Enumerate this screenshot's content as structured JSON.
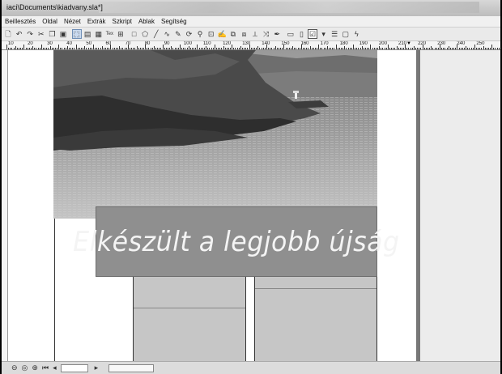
{
  "window": {
    "title": "iaci\\Documents\\kiadvany.sla*]"
  },
  "menu": [
    "Beillesztés",
    "Oldal",
    "Nézet",
    "Extrák",
    "Szkript",
    "Ablak",
    "Segítség"
  ],
  "toolbar": {
    "icons": [
      "new-icon",
      "undo-icon",
      "redo-icon",
      "cut-icon",
      "copy-icon",
      "paste-icon",
      "select-icon",
      "text-frame-icon",
      "image-frame-icon",
      "text-annotation-icon",
      "table-icon",
      "shape-icon",
      "polygon-icon",
      "line-icon",
      "bezier-icon",
      "freehand-icon",
      "rotate-icon",
      "zoom-icon",
      "edit-content-icon",
      "edit-text-icon",
      "link-frames-icon",
      "unlink-frames-icon",
      "measure-icon",
      "copy-properties-icon",
      "eyedropper-icon",
      "pdf-pushbutton-icon",
      "pdf-textfield-icon",
      "pdf-checkbox-icon",
      "pdf-combobox-icon",
      "pdf-listbox-icon",
      "pdf-annotation-icon",
      "pdf-link-icon"
    ],
    "table_glyph": "Tex",
    "lightning_glyph": "ϟ"
  },
  "ruler": {
    "labels": [
      "10",
      "20",
      "30",
      "40",
      "50",
      "60",
      "70",
      "80",
      "90",
      "100",
      "110",
      "120",
      "130",
      "140",
      "150",
      "160",
      "170",
      "180",
      "190",
      "200",
      "210",
      "220",
      "230",
      "240",
      "250"
    ]
  },
  "document": {
    "headline": "Elkészült a legjobb újság",
    "photo_subject": "coastal cliffs and sea with lighthouse"
  },
  "statusbar": {
    "icons": [
      "zoom-out-icon",
      "zoom-default-icon",
      "zoom-in-icon",
      "first-page-icon",
      "prev-page-icon"
    ]
  }
}
